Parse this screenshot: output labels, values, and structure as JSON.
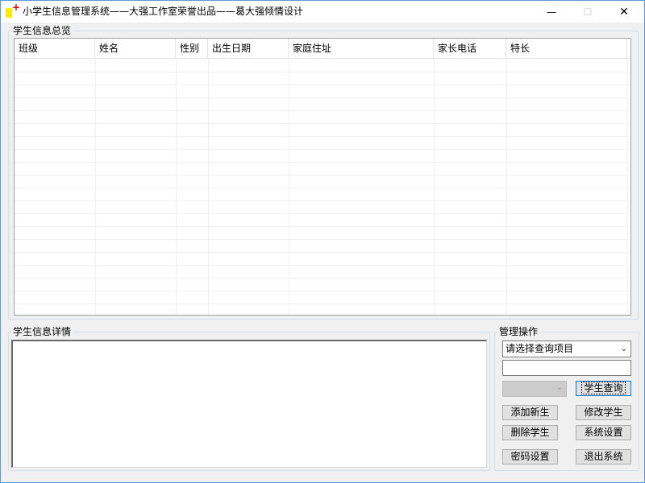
{
  "window": {
    "title": "小学生信息管理系统——大强工作室荣誉出品——葛大强倾情设计",
    "min_glyph": "—",
    "max_glyph": "☐",
    "close_glyph": "✕"
  },
  "overview": {
    "legend": "学生信息总览",
    "columns": [
      "班级",
      "姓名",
      "性别",
      "出生日期",
      "家庭住址",
      "家长电话",
      "特长"
    ]
  },
  "detail": {
    "legend": "学生信息详情",
    "text": ""
  },
  "manage": {
    "legend": "管理操作",
    "query_field_selected": "请选择查询项目",
    "query_value": "",
    "query_button": "学生查询",
    "add_button": "添加新生",
    "edit_button": "修改学生",
    "delete_button": "删除学生",
    "settings_button": "系统设置",
    "password_button": "密码设置",
    "exit_button": "退出系统"
  }
}
